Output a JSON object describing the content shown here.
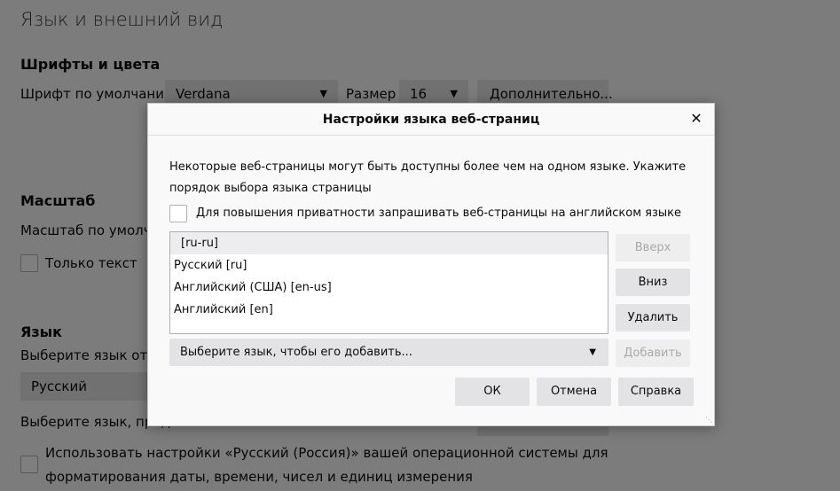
{
  "page": {
    "heading": "Язык и внешний вид",
    "fonts_section": {
      "title": "Шрифты и цвета",
      "default_font_label": "Шрифт по умолчанию",
      "default_font_value": "Verdana",
      "size_label": "Размер",
      "size_value": "16",
      "advanced_button": "Дополнительно..."
    },
    "zoom_section": {
      "title": "Масштаб",
      "default_zoom_label": "Масштаб по умолча",
      "text_only_label": "Только текст"
    },
    "language_section": {
      "title": "Язык",
      "display_language_label": "Выберите язык отоб",
      "display_language_value": "Русский",
      "page_language_label": "Выберите язык, пред",
      "use_os_settings_label_line1": "Использовать настройки «Русский (Россия)» вашей операционной системы для",
      "use_os_settings_label_line2": "форматирования даты, времени, чисел и единиц измерения"
    }
  },
  "dialog": {
    "title": "Настройки языка веб-страниц",
    "close_icon": "close-icon",
    "description": "Некоторые веб-страницы могут быть доступны более чем на одном языке. Укажите порядок выбора языка страницы",
    "privacy_checkbox_label": "Для повышения приватности запрашивать веб-страницы на английском языке",
    "languages": [
      {
        "label": "[ru-ru]",
        "selected": true
      },
      {
        "label": "Русский  [ru]",
        "selected": false
      },
      {
        "label": "Английский (США)  [en-us]",
        "selected": false
      },
      {
        "label": "Английский  [en]",
        "selected": false
      }
    ],
    "buttons": {
      "up": "Вверх",
      "down": "Вниз",
      "remove": "Удалить",
      "add": "Добавить",
      "ok": "ОК",
      "cancel": "Отмена",
      "help": "Справка"
    },
    "add_select_placeholder": "Выберите язык, чтобы его добавить..."
  }
}
